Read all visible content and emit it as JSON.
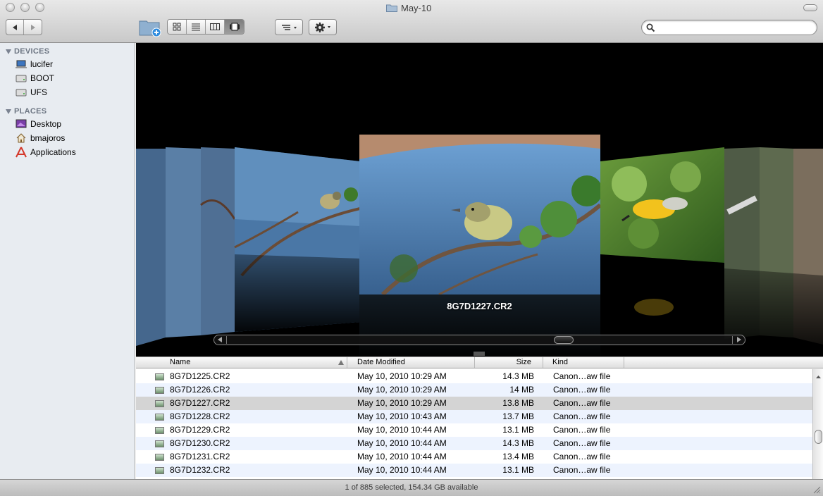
{
  "window": {
    "title": "May-10"
  },
  "toolbar": {
    "back_label": "◀",
    "forward_label": "▶",
    "search_placeholder": "",
    "search_value": ""
  },
  "sidebar": {
    "sections": [
      {
        "header": "DEVICES",
        "items": [
          {
            "label": "lucifer",
            "icon": "laptop-icon"
          },
          {
            "label": "BOOT",
            "icon": "disk-icon"
          },
          {
            "label": "UFS",
            "icon": "disk-icon"
          }
        ]
      },
      {
        "header": "PLACES",
        "items": [
          {
            "label": "Desktop",
            "icon": "desktop-icon"
          },
          {
            "label": "bmajoros",
            "icon": "home-icon"
          },
          {
            "label": "Applications",
            "icon": "applications-icon"
          }
        ]
      }
    ]
  },
  "coverflow": {
    "caption": "8G7D1227.CR2"
  },
  "list": {
    "columns": [
      "Name",
      "Date Modified",
      "Size",
      "Kind"
    ],
    "sort_column": "Name",
    "rows": [
      {
        "name": "8G7D1225.CR2",
        "date": "May 10, 2010 10:29 AM",
        "size": "14.3 MB",
        "kind": "Canon…aw file"
      },
      {
        "name": "8G7D1226.CR2",
        "date": "May 10, 2010 10:29 AM",
        "size": "14 MB",
        "kind": "Canon…aw file"
      },
      {
        "name": "8G7D1227.CR2",
        "date": "May 10, 2010 10:29 AM",
        "size": "13.8 MB",
        "kind": "Canon…aw file"
      },
      {
        "name": "8G7D1228.CR2",
        "date": "May 10, 2010 10:43 AM",
        "size": "13.7 MB",
        "kind": "Canon…aw file"
      },
      {
        "name": "8G7D1229.CR2",
        "date": "May 10, 2010 10:44 AM",
        "size": "13.1 MB",
        "kind": "Canon…aw file"
      },
      {
        "name": "8G7D1230.CR2",
        "date": "May 10, 2010 10:44 AM",
        "size": "14.3 MB",
        "kind": "Canon…aw file"
      },
      {
        "name": "8G7D1231.CR2",
        "date": "May 10, 2010 10:44 AM",
        "size": "13.4 MB",
        "kind": "Canon…aw file"
      },
      {
        "name": "8G7D1232.CR2",
        "date": "May 10, 2010 10:44 AM",
        "size": "13.1 MB",
        "kind": "Canon…aw file"
      }
    ],
    "selected_index": 2
  },
  "status": {
    "text": "1 of 885 selected, 154.34 GB available"
  },
  "colors": {
    "sidebar_bg": "#e8ecf1",
    "row_alt": "#edf3fe",
    "row_selected": "#d4d4d4",
    "coverflow_bg": "#000000"
  }
}
